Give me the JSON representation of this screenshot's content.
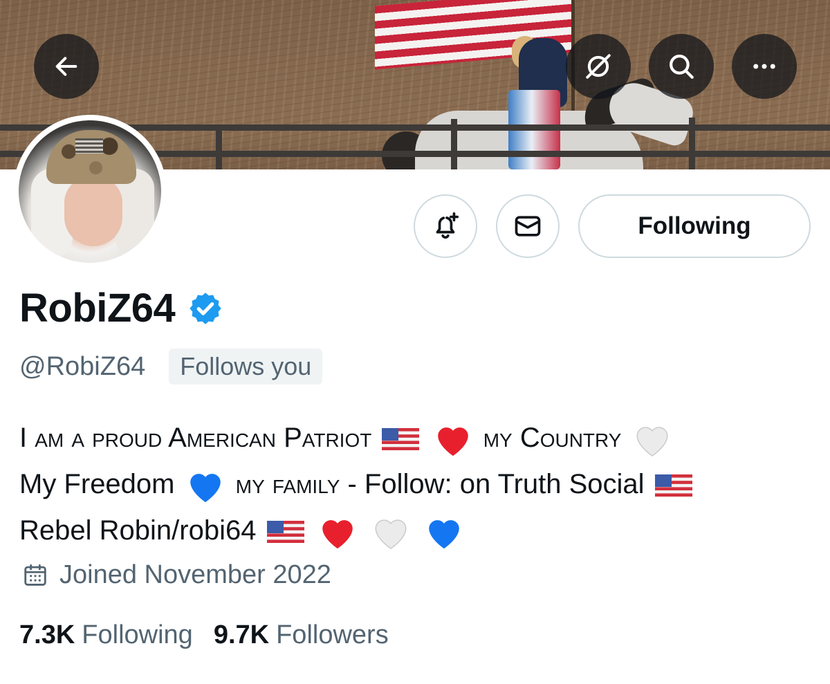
{
  "header": {
    "back_icon": "arrow-left-icon",
    "grok_icon": "grok-icon",
    "search_icon": "search-icon",
    "more_icon": "more-horizontal-icon"
  },
  "actions": {
    "notify_icon": "bell-plus-icon",
    "message_icon": "envelope-icon",
    "following_label": "Following"
  },
  "profile": {
    "display_name": "RobiZ64",
    "handle": "@RobiZ64",
    "follows_you": "Follows you",
    "verified_color": "#1d9bf0",
    "bio": {
      "line1_a": "I am a proud American Patriot",
      "line1_b": "my Country",
      "line2_a": "My Freedom",
      "line2_b": "my family",
      "line2_c": "- Follow: on Truth Social",
      "line3_a": "Rebel Robin/robi64"
    },
    "joined": "Joined November 2022",
    "following_count": "7.3K",
    "following_label": "Following",
    "followers_count": "9.7K",
    "followers_label": "Followers"
  }
}
